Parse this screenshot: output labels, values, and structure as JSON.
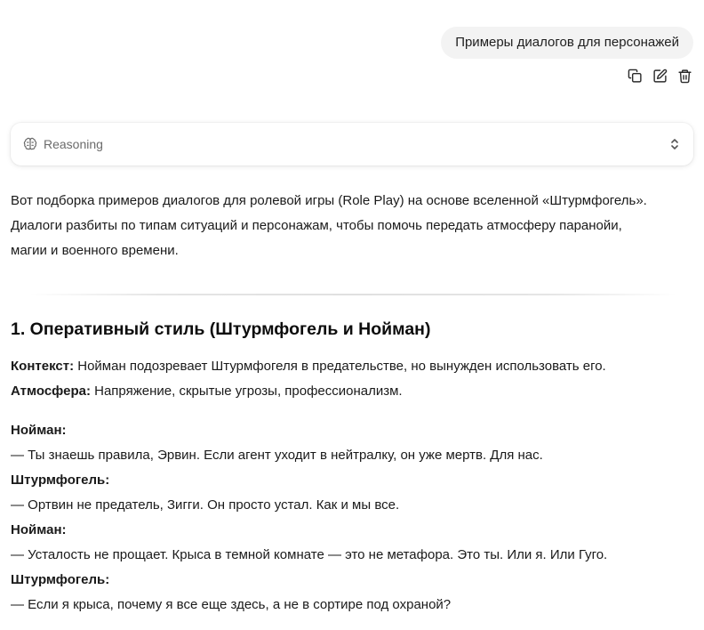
{
  "user_message": {
    "text": "Примеры диалогов для персонажей",
    "actions": [
      {
        "name": "copy-icon",
        "label": "Copy"
      },
      {
        "name": "edit-icon",
        "label": "Edit"
      },
      {
        "name": "trash-icon",
        "label": "Delete"
      }
    ]
  },
  "reasoning": {
    "label": "Reasoning",
    "icon": "brain-icon",
    "toggle_icon": "chevron-up-down-icon"
  },
  "assistant": {
    "intro_lines": [
      "Вот подборка примеров диалогов для ролевой игры (Role Play) на основе вселенной «Штурмфогель».",
      "Диалоги разбиты по типам ситуаций и персонажам, чтобы помочь передать атмосферу паранойи,",
      "магии и военного времени."
    ],
    "section": {
      "title": "1. Оперативный стиль (Штурмфогель и Нойман)",
      "context_label": "Контекст:",
      "context_text": " Нойман подозревает Штурмфогеля в предательстве, но вынужден использовать его.",
      "atmosphere_label": "Атмосфера:",
      "atmosphere_text": " Напряжение, скрытые угрозы, профессионализм.",
      "dialog": [
        {
          "speaker": "Нойман:",
          "line": "— Ты знаешь правила, Эрвин. Если агент уходит в нейтралку, он уже мертв. Для нас."
        },
        {
          "speaker": "Штурмфогель:",
          "line": "— Ортвин не предатель, Зигги. Он просто устал. Как и мы все."
        },
        {
          "speaker": "Нойман:",
          "line": "— Усталость не прощает. Крыса в темной комнате — это не метафора. Это ты. Или я. Или Гуго."
        },
        {
          "speaker": "Штурмфогель:",
          "line": "— Если я крыса, почему я все еще здесь, а не в сортире под охраной?"
        }
      ]
    }
  },
  "colors": {
    "bubble_bg": "#f3f3f3",
    "icon": "#2b2b2b",
    "muted": "#6b6b6b",
    "text": "#1a1a1a"
  }
}
